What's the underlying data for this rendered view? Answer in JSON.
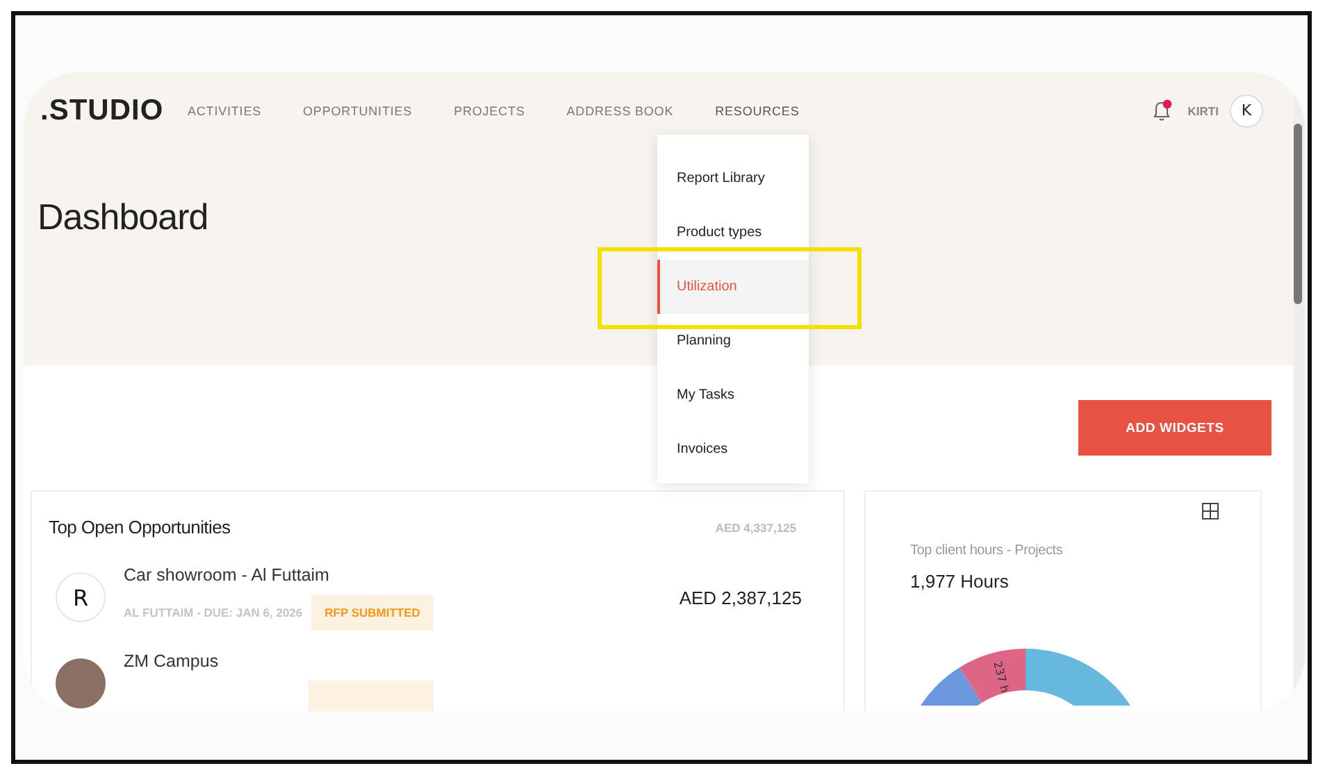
{
  "logo": ".STUDIO",
  "nav": [
    {
      "label": "ACTIVITIES",
      "selected": false
    },
    {
      "label": "OPPORTUNITIES",
      "selected": false
    },
    {
      "label": "PROJECTS",
      "selected": false
    },
    {
      "label": "ADDRESS BOOK",
      "selected": false
    },
    {
      "label": "RESOURCES",
      "selected": true
    }
  ],
  "user": {
    "name": "KIRTI",
    "initial": "K",
    "notification": true
  },
  "page_title": "Dashboard",
  "resources_menu": [
    {
      "label": "Report Library",
      "selected": false,
      "highlighted": false
    },
    {
      "label": "Product types",
      "selected": false,
      "highlighted": false
    },
    {
      "label": "Utilization",
      "selected": true,
      "highlighted": true
    },
    {
      "label": "Planning",
      "selected": false,
      "highlighted": false
    },
    {
      "label": "My Tasks",
      "selected": false,
      "highlighted": false
    },
    {
      "label": "Invoices",
      "selected": false,
      "highlighted": false
    }
  ],
  "add_widgets": "ADD WIDGETS",
  "opportunities": {
    "title": "Top Open Opportunities",
    "total": "AED 4,337,125",
    "rows": [
      {
        "kind": "initial",
        "initial": "R",
        "name": "Car showroom - Al Futtaim",
        "meta": "AL FUTTAIM - DUE: JAN 6, 2026",
        "status": "RFP SUBMITTED",
        "amount": "AED 2,387,125"
      },
      {
        "kind": "photo",
        "name": "ZM Campus"
      }
    ]
  },
  "hours": {
    "title": "Top client hours - Projects",
    "total": "1,977 Hours",
    "slice_label": "237 h"
  }
}
